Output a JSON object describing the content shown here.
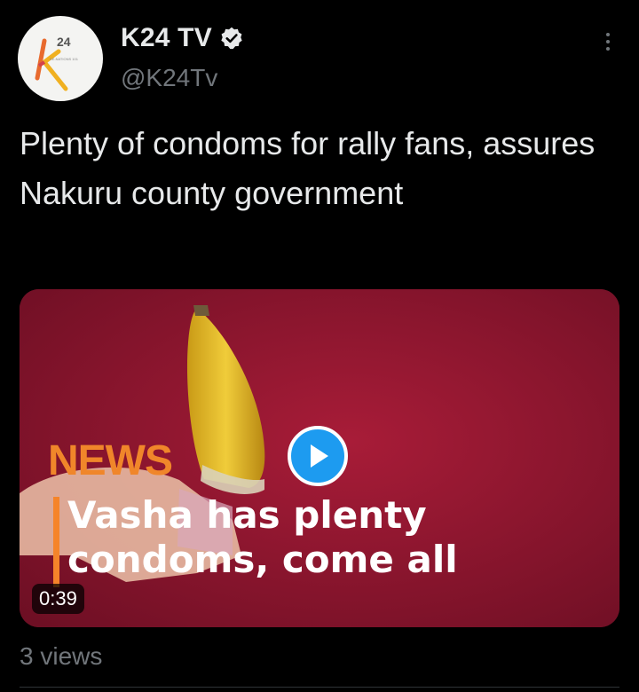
{
  "author": {
    "display_name": "K24 TV",
    "handle": "@K24Tv",
    "avatar_text": "24",
    "avatar_tagline": "KE-NATIONS 101"
  },
  "tweet": {
    "text": "Plenty of condoms for rally fans, assures Nakuru county government",
    "views": "3 views"
  },
  "media": {
    "news_label": "NEWS",
    "headline_line1": "Vasha has plenty",
    "headline_line2": "condoms, come all",
    "duration": "0:39"
  },
  "colors": {
    "background": "#000000",
    "accent_blue": "#1d9bf0",
    "news_orange": "#f0862a",
    "media_red": "#8e1630"
  },
  "icons": {
    "verified": "verified-badge-icon",
    "more": "more-options-icon",
    "play": "play-icon"
  }
}
